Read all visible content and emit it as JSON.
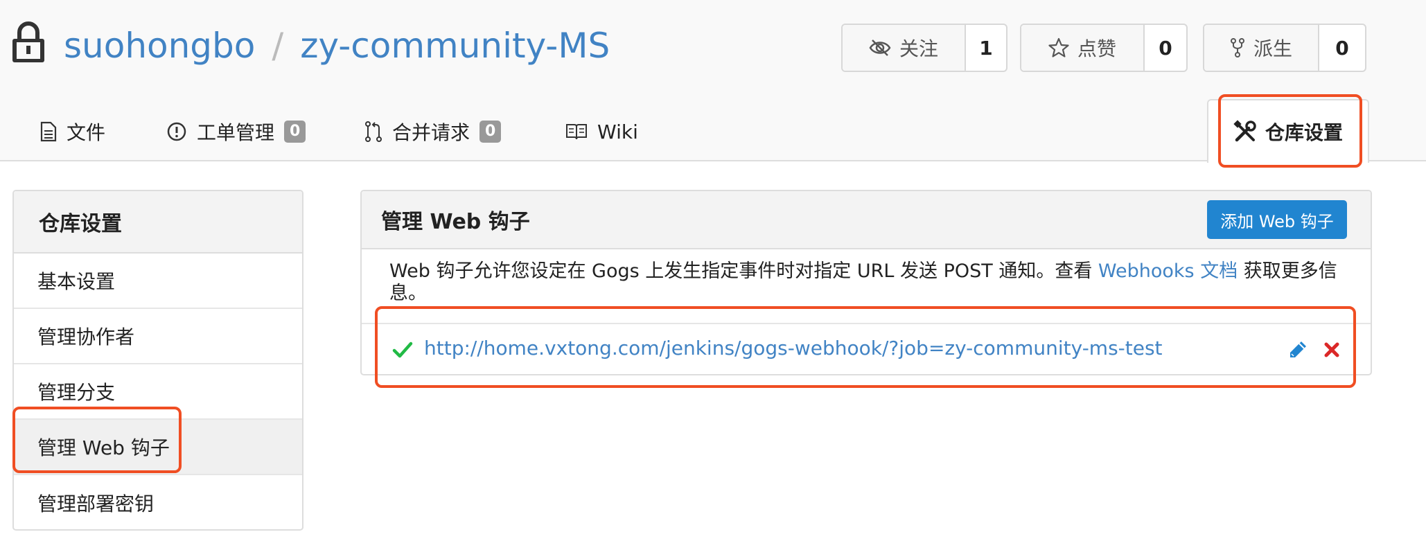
{
  "repo": {
    "owner": "suohongbo",
    "separator": "/",
    "name": "zy-community-MS"
  },
  "actions": {
    "watch": {
      "label": "关注",
      "count": "1",
      "icon": "eye-slash-icon"
    },
    "star": {
      "label": "点赞",
      "count": "0",
      "icon": "star-icon"
    },
    "fork": {
      "label": "派生",
      "count": "0",
      "icon": "fork-icon"
    }
  },
  "tabs": {
    "files": {
      "label": "文件",
      "icon": "file-icon"
    },
    "issues": {
      "label": "工单管理",
      "badge": "0",
      "icon": "issue-icon"
    },
    "pulls": {
      "label": "合并请求",
      "badge": "0",
      "icon": "pull-request-icon"
    },
    "wiki": {
      "label": "Wiki",
      "icon": "book-icon"
    },
    "settings": {
      "label": "仓库设置",
      "icon": "tools-icon"
    }
  },
  "sidebar": {
    "title": "仓库设置",
    "items": [
      {
        "label": "基本设置"
      },
      {
        "label": "管理协作者"
      },
      {
        "label": "管理分支"
      },
      {
        "label": "管理 Web 钩子",
        "active": true
      },
      {
        "label": "管理部署密钥"
      }
    ]
  },
  "webhooks": {
    "title": "管理 Web 钩子",
    "add_button": "添加 Web 钩子",
    "desc_before": "Web 钩子允许您设定在 Gogs 上发生指定事件时对指定 URL 发送 POST 通知。查看 ",
    "desc_link": "Webhooks 文档",
    "desc_after": " 获取更多信息。",
    "hooks": [
      {
        "url": "http://home.vxtong.com/jenkins/gogs-webhook/?job=zy-community-ms-test",
        "status": "success"
      }
    ]
  },
  "colors": {
    "link": "#4183c4",
    "primary_button": "#2185d0",
    "highlight": "#f04e23",
    "success": "#21ba45",
    "danger": "#db2828"
  }
}
